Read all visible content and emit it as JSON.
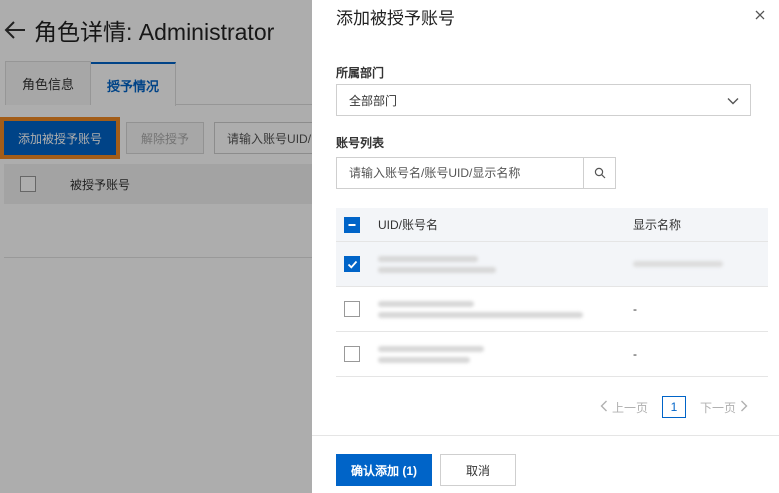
{
  "background": {
    "page_title": "角色详情: Administrator",
    "tabs": [
      {
        "label": "角色信息",
        "active": false
      },
      {
        "label": "授予情况",
        "active": true
      }
    ],
    "toolbar": {
      "add_button": "添加被授予账号",
      "remove_button": "解除授予",
      "search_placeholder": "请输入账号UID/"
    },
    "table": {
      "column_account": "被授予账号"
    }
  },
  "drawer": {
    "title": "添加被授予账号",
    "department": {
      "label": "所属部门",
      "value": "全部部门"
    },
    "account_list": {
      "label": "账号列表",
      "search_placeholder": "请输入账号名/账号UID/显示名称",
      "columns": {
        "uid": "UID/账号名",
        "display_name": "显示名称"
      },
      "rows": [
        {
          "checked": true,
          "display_name": ""
        },
        {
          "checked": false,
          "display_name": "-"
        },
        {
          "checked": false,
          "display_name": "-"
        }
      ]
    },
    "pagination": {
      "prev": "上一页",
      "current_page": "1",
      "next": "下一页"
    },
    "footer": {
      "confirm": "确认添加 (1)",
      "cancel": "取消"
    }
  },
  "colors": {
    "primary": "#0064c8",
    "highlight_outline": "#f08a24",
    "overlay": "rgba(0,0,0,0.32)"
  },
  "icons": [
    "back-arrow-icon",
    "close-icon",
    "chevron-down-icon",
    "search-icon",
    "checkbox-indeterminate-icon",
    "checkmark-icon",
    "chevron-left-icon",
    "chevron-right-icon"
  ]
}
